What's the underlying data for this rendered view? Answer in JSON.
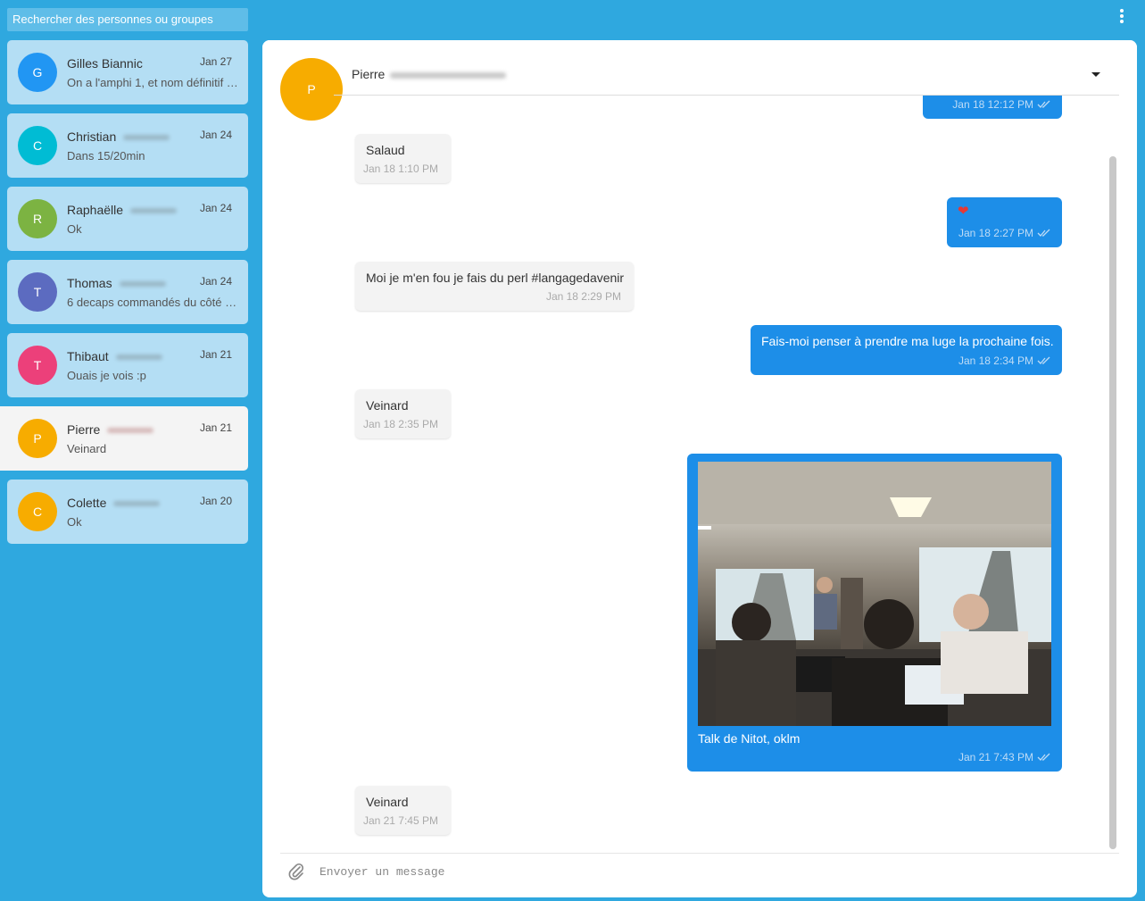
{
  "search": {
    "placeholder": "Rechercher des personnes ou groupes"
  },
  "conversations": [
    {
      "initial": "G",
      "name": "Gilles Biannic",
      "date": "Jan 27",
      "preview": "On a l'amphi 1, et nom définitif \"…",
      "color": "#2196f3"
    },
    {
      "initial": "C",
      "name": "Christian",
      "date": "Jan 24",
      "preview": "Dans 15/20min",
      "color": "#00bcd4"
    },
    {
      "initial": "R",
      "name": "Raphaëlle",
      "date": "Jan 24",
      "preview": "Ok",
      "color": "#7cb342"
    },
    {
      "initial": "T",
      "name": "Thomas",
      "date": "Jan 24",
      "preview": "6 decaps commandés du côté d…",
      "color": "#5c6bc0"
    },
    {
      "initial": "T",
      "name": "Thibaut",
      "date": "Jan 21",
      "preview": "Ouais je vois :p",
      "color": "#ec407a"
    },
    {
      "initial": "P",
      "name": "Pierre",
      "date": "Jan 21",
      "preview": "Veinard",
      "color": "#f7ac00",
      "active": true
    },
    {
      "initial": "C",
      "name": "Colette",
      "date": "Jan 20",
      "preview": "Ok",
      "color": "#f7ac00"
    }
  ],
  "header": {
    "initial": "P",
    "name": "Pierre"
  },
  "messages": [
    {
      "dir": "out",
      "text": "",
      "time": "Jan 18 12:12 PM"
    },
    {
      "dir": "in",
      "text": "Salaud",
      "time": "Jan 18 1:10 PM"
    },
    {
      "dir": "out",
      "text": "❤",
      "time": "Jan 18 2:27 PM"
    },
    {
      "dir": "in",
      "text": "Moi je m'en fou je fais du perl #langagedavenir",
      "time": "Jan 18 2:29 PM"
    },
    {
      "dir": "out",
      "text": "Fais-moi penser à prendre ma luge la prochaine fois.",
      "time": "Jan 18 2:34 PM"
    },
    {
      "dir": "in",
      "text": "Veinard",
      "time": "Jan 18 2:35 PM"
    },
    {
      "dir": "out",
      "text": "Talk de Nitot, oklm",
      "time": "Jan 21 7:43 PM",
      "image": "conference-room-photo"
    },
    {
      "dir": "in",
      "text": "Veinard",
      "time": "Jan 21 7:45 PM"
    }
  ],
  "compose": {
    "placeholder": "Envoyer un message"
  },
  "colors": {
    "background": "#2fa8df",
    "outgoing": "#1d8ee8",
    "incoming": "#f3f3f3",
    "heart": "#e53935"
  }
}
